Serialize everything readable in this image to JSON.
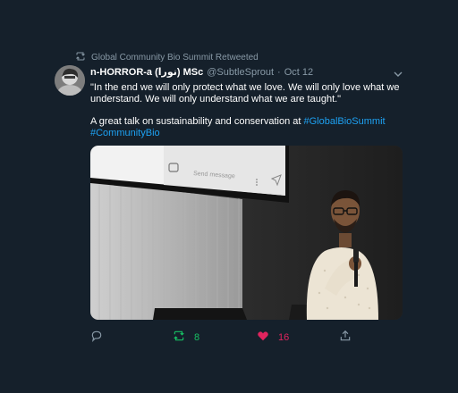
{
  "retweet_context": {
    "label": "Global Community Bio Summit Retweeted"
  },
  "author": {
    "display_name": "n-HORROR-a (نورا) MSc",
    "handle": "@SubtleSprout",
    "separator": "·",
    "date": "Oct 12"
  },
  "tweet": {
    "line1": "\"In the end we will only protect what we love. We will only love what we",
    "line2": "understand. We will only understand what we are taught.\"",
    "line3_text": "A great talk on sustainability and conservation at ",
    "hashtag1": "#GlobalBioSummit",
    "hashtag2": "#CommunityBio"
  },
  "media": {
    "screen_text": "Send message"
  },
  "actions": {
    "retweet_count": "8",
    "like_count": "16"
  },
  "colors": {
    "background": "#15202b",
    "accent": "#1da1f2",
    "retweet": "#17bf63",
    "like": "#e0245e",
    "muted": "#8899a6"
  },
  "icons": [
    "retweet-icon",
    "chevron-down-icon",
    "reply-icon",
    "retweet-icon",
    "heart-icon",
    "share-icon"
  ]
}
